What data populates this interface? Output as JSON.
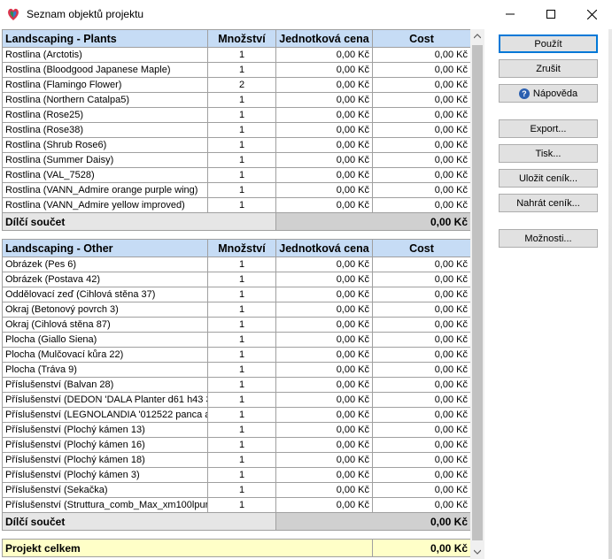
{
  "window": {
    "title": "Seznam objektů projektu"
  },
  "columns": {
    "quantity": "Množství",
    "unit_price": "Jednotková cena",
    "cost": "Cost"
  },
  "sections": [
    {
      "name": "Landscaping - Plants",
      "rows": [
        {
          "name": "Rostlina (Arctotis)",
          "qty": "1",
          "unit": "0,00 Kč",
          "cost": "0,00 Kč"
        },
        {
          "name": "Rostlina (Bloodgood Japanese Maple)",
          "qty": "1",
          "unit": "0,00 Kč",
          "cost": "0,00 Kč"
        },
        {
          "name": "Rostlina (Flamingo Flower)",
          "qty": "2",
          "unit": "0,00 Kč",
          "cost": "0,00 Kč"
        },
        {
          "name": "Rostlina (Northern Catalpa5)",
          "qty": "1",
          "unit": "0,00 Kč",
          "cost": "0,00 Kč"
        },
        {
          "name": "Rostlina (Rose25)",
          "qty": "1",
          "unit": "0,00 Kč",
          "cost": "0,00 Kč"
        },
        {
          "name": "Rostlina (Rose38)",
          "qty": "1",
          "unit": "0,00 Kč",
          "cost": "0,00 Kč"
        },
        {
          "name": "Rostlina (Shrub Rose6)",
          "qty": "1",
          "unit": "0,00 Kč",
          "cost": "0,00 Kč"
        },
        {
          "name": "Rostlina (Summer Daisy)",
          "qty": "1",
          "unit": "0,00 Kč",
          "cost": "0,00 Kč"
        },
        {
          "name": "Rostlina (VAL_7528)",
          "qty": "1",
          "unit": "0,00 Kč",
          "cost": "0,00 Kč"
        },
        {
          "name": "Rostlina (VANN_Admire orange purple wing)",
          "qty": "1",
          "unit": "0,00 Kč",
          "cost": "0,00 Kč"
        },
        {
          "name": "Rostlina (VANN_Admire yellow improved)",
          "qty": "1",
          "unit": "0,00 Kč",
          "cost": "0,00 Kč"
        }
      ],
      "subtotal_label": "Dílčí součet",
      "subtotal": "0,00 Kč"
    },
    {
      "name": "Landscaping - Other",
      "rows": [
        {
          "name": "Obrázek (Pes 6)",
          "qty": "1",
          "unit": "0,00 Kč",
          "cost": "0,00 Kč"
        },
        {
          "name": "Obrázek (Postava 42)",
          "qty": "1",
          "unit": "0,00 Kč",
          "cost": "0,00 Kč"
        },
        {
          "name": "Oddělovací zeď (Cihlová stěna 37)",
          "qty": "1",
          "unit": "0,00 Kč",
          "cost": "0,00 Kč"
        },
        {
          "name": "Okraj (Betonový povrch 3)",
          "qty": "1",
          "unit": "0,00 Kč",
          "cost": "0,00 Kč"
        },
        {
          "name": "Okraj (Cihlová stěna 87)",
          "qty": "1",
          "unit": "0,00 Kč",
          "cost": "0,00 Kč"
        },
        {
          "name": "Plocha (Giallo Siena)",
          "qty": "1",
          "unit": "0,00 Kč",
          "cost": "0,00 Kč"
        },
        {
          "name": "Plocha (Mulčovací kůra 22)",
          "qty": "1",
          "unit": "0,00 Kč",
          "cost": "0,00 Kč"
        },
        {
          "name": "Plocha (Tráva 9)",
          "qty": "1",
          "unit": "0,00 Kč",
          "cost": "0,00 Kč"
        },
        {
          "name": "Příslušenství (Balvan 28)",
          "qty": "1",
          "unit": "0,00 Kč",
          "cost": "0,00 Kč"
        },
        {
          "name": "Příslušenství (DEDON 'DALA Planter d61 h43 3",
          "qty": "1",
          "unit": "0,00 Kč",
          "cost": "0,00 Kč"
        },
        {
          "name": "Příslušenství (LEGNOLANDIA '012522 panca a",
          "qty": "1",
          "unit": "0,00 Kč",
          "cost": "0,00 Kč"
        },
        {
          "name": "Příslušenství (Plochý kámen 13)",
          "qty": "1",
          "unit": "0,00 Kč",
          "cost": "0,00 Kč"
        },
        {
          "name": "Příslušenství (Plochý kámen 16)",
          "qty": "1",
          "unit": "0,00 Kč",
          "cost": "0,00 Kč"
        },
        {
          "name": "Příslušenství (Plochý kámen 18)",
          "qty": "1",
          "unit": "0,00 Kč",
          "cost": "0,00 Kč"
        },
        {
          "name": "Příslušenství (Plochý kámen 3)",
          "qty": "1",
          "unit": "0,00 Kč",
          "cost": "0,00 Kč"
        },
        {
          "name": "Příslušenství (Sekačka)",
          "qty": "1",
          "unit": "0,00 Kč",
          "cost": "0,00 Kč"
        },
        {
          "name": "Příslušenství (Struttura_comb_Max_xm100lpur -",
          "qty": "1",
          "unit": "0,00 Kč",
          "cost": "0,00 Kč"
        }
      ],
      "subtotal_label": "Dílčí součet",
      "subtotal": "0,00 Kč"
    }
  ],
  "total": {
    "label": "Projekt celkem",
    "value": "0,00 Kč"
  },
  "buttons": {
    "apply": "Použít",
    "cancel": "Zrušit",
    "help": "Nápověda",
    "export": "Export...",
    "print": "Tisk...",
    "save_pricelist": "Uložit ceník...",
    "load_pricelist": "Nahrát ceník...",
    "options": "Možnosti..."
  },
  "colors": {
    "header_bg": "#c6dcf5",
    "subtotal_bg": "#e6e6e6",
    "total_bg": "#ffffc8",
    "accent": "#0078d7"
  },
  "icons": [
    "app-icon",
    "minimize-icon",
    "maximize-icon",
    "close-icon",
    "scroll-up-icon",
    "scroll-down-icon",
    "help-icon"
  ]
}
